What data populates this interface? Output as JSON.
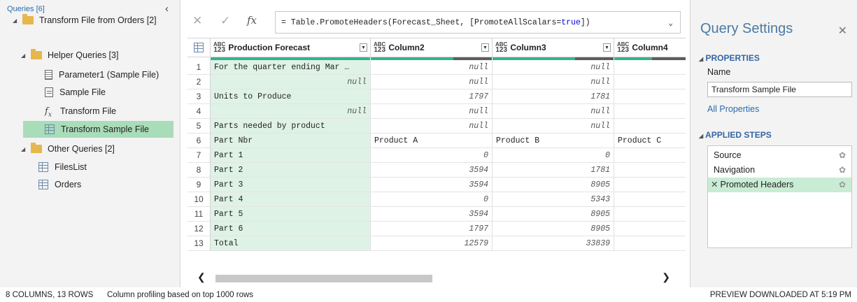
{
  "queries": {
    "header": "Queries [6]",
    "collapse_icon": "chevron-left-icon",
    "tree": {
      "transform_group": "Transform File from Orders [2]",
      "helper_group": "Helper Queries [3]",
      "parameter1": "Parameter1 (Sample File)",
      "sample_file": "Sample File",
      "transform_file": "Transform File",
      "transform_sample": "Transform Sample File",
      "other_group": "Other Queries [2]",
      "files_list": "FilesList",
      "orders": "Orders"
    }
  },
  "formula": {
    "cancel_icon": "close-icon",
    "commit_icon": "check-icon",
    "fx_label": "fx",
    "prefix": "= Table.PromoteHeaders(Forecast_Sheet, [PromoteAllScalars=",
    "keyword": "true",
    "suffix": "])"
  },
  "grid": {
    "columns": [
      {
        "type_top": "ABC",
        "type_bottom": "123",
        "name": "Production Forecast"
      },
      {
        "type_top": "ABC",
        "type_bottom": "123",
        "name": "Column2"
      },
      {
        "type_top": "ABC",
        "type_bottom": "123",
        "name": "Column3"
      },
      {
        "type_top": "ABC",
        "type_bottom": "123",
        "name": "Column4"
      }
    ],
    "rows": [
      {
        "n": "1",
        "c1": "For the quarter ending Mar …",
        "c2": "null",
        "c3": "null",
        "c4": ""
      },
      {
        "n": "2",
        "c1": "null",
        "c2": "null",
        "c3": "null",
        "c4": ""
      },
      {
        "n": "3",
        "c1": "Units to Produce",
        "c2": "1797",
        "c3": "1781",
        "c4": ""
      },
      {
        "n": "4",
        "c1": "null",
        "c2": "null",
        "c3": "null",
        "c4": ""
      },
      {
        "n": "5",
        "c1": "Parts needed by product",
        "c2": "null",
        "c3": "null",
        "c4": ""
      },
      {
        "n": "6",
        "c1": "Part Nbr",
        "c2": "Product A",
        "c3": "Product B",
        "c4": "Product C"
      },
      {
        "n": "7",
        "c1": "Part 1",
        "c2": "0",
        "c3": "0",
        "c4": ""
      },
      {
        "n": "8",
        "c1": "Part 2",
        "c2": "3594",
        "c3": "1781",
        "c4": ""
      },
      {
        "n": "9",
        "c1": "Part 3",
        "c2": "3594",
        "c3": "8905",
        "c4": ""
      },
      {
        "n": "10",
        "c1": "Part 4",
        "c2": "0",
        "c3": "5343",
        "c4": ""
      },
      {
        "n": "11",
        "c1": "Part 5",
        "c2": "3594",
        "c3": "8905",
        "c4": ""
      },
      {
        "n": "12",
        "c1": "Part 6",
        "c2": "1797",
        "c3": "8905",
        "c4": ""
      },
      {
        "n": "13",
        "c1": "Total",
        "c2": "12579",
        "c3": "33839",
        "c4": ""
      }
    ]
  },
  "settings": {
    "title": "Query Settings",
    "properties_header": "PROPERTIES",
    "name_label": "Name",
    "name_value": "Transform Sample File",
    "all_properties": "All Properties",
    "applied_steps_header": "APPLIED STEPS",
    "steps": [
      "Source",
      "Navigation",
      "Promoted Headers"
    ]
  },
  "status": {
    "counts": "8 COLUMNS, 13 ROWS",
    "profiling": "Column profiling based on top 1000 rows",
    "preview": "PREVIEW DOWNLOADED AT 5:19 PM"
  },
  "colors": {
    "selection": "#a9dcb9",
    "quality_bar": "#35b38f",
    "accent": "#4a7aa5"
  }
}
